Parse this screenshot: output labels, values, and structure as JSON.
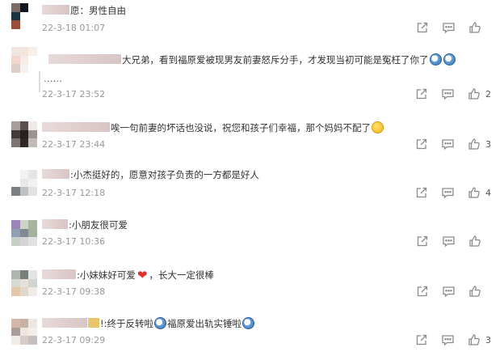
{
  "comments": [
    {
      "avatar": [
        "#7b6b66",
        "#0f1620",
        "#ffffff",
        "#1a3340",
        "#ffffff",
        "#ffffff",
        "#9a4b3c",
        "#ffffff",
        "#ffffff"
      ],
      "prefix": "愿：",
      "text": "男性自由",
      "time": "22-3-18 01:07",
      "likes": "",
      "icons": [
        "share-icon",
        "comment-icon",
        "like-icon"
      ]
    },
    {
      "avatar": [
        "#efe6e2",
        "#f3e4dc",
        "#f8efe9",
        "#f4d6cf",
        "#f5ece8",
        "#ffffff",
        "#ddcfc8",
        "#f7f2ef",
        "#ffffff"
      ],
      "prefix": "大兄弟",
      "text": "，看到福原爱被现男友前妻怒斥分手，才发现当初可能是冤枉了你了",
      "reply": "……",
      "time": "22-3-17 23:52",
      "likes": "2",
      "icons": [
        "share-icon",
        "comment-icon",
        "like-icon"
      ]
    },
    {
      "avatar": [
        "#a79e99",
        "#5a5050",
        "#efe9e6",
        "#433b39",
        "#291f20",
        "#9c938f",
        "#7e7572",
        "#2d2728",
        "#c2bbb7"
      ],
      "prefix": "",
      "text": "唉一句前妻的坏话也没说，祝您和孩子们幸福，那个妈妈不配了",
      "time": "22-3-17 23:44",
      "likes": "3",
      "icons": [
        "share-icon",
        "comment-icon",
        "like-icon"
      ]
    },
    {
      "avatar": [
        "#ffffff",
        "#f2f2f2",
        "#e5e5e5",
        "#ffffff",
        "#e8e8e8",
        "#f1f1f1",
        "#7c7e83",
        "#bfc0c2",
        "#e2e2e2"
      ],
      "prefix": "",
      "text": ":小杰挺好的，愿意对孩子负责的一方都是好人",
      "time": "22-3-17 12:18",
      "likes": "4",
      "icons": [
        "share-icon",
        "comment-icon",
        "like-icon"
      ]
    },
    {
      "avatar": [
        "#9a86b6",
        "#cdd4c6",
        "#a8b59a",
        "#8fa0b2",
        "#7f8a91",
        "#a4b19d",
        "#c8cfc4",
        "#d5d5d5",
        "#e2e2e2"
      ],
      "prefix": "",
      "text": ":小朋友很可爱",
      "time": "22-3-17 10:36",
      "likes": "",
      "icons": [
        "share-icon",
        "comment-icon",
        "like-icon"
      ]
    },
    {
      "avatar": [
        "#aeb4ae",
        "#777f79",
        "#e3e4e3",
        "#d6dad3",
        "#e7e0d8",
        "#d2d5cd",
        "#e3c8aa",
        "#ded8cf",
        "#f0ebe6"
      ],
      "prefix": "",
      "text": ":小妹妹好可爱",
      "text2": "，长大一定很棒",
      "time": "22-3-17 09:38",
      "likes": "",
      "icons": [
        "share-icon",
        "comment-icon",
        "like-icon"
      ]
    },
    {
      "avatar": [
        "#d4b9aa",
        "#c7b1a6",
        "#ece7e3",
        "#a99c99",
        "#f0e6e0",
        "#f5ede8",
        "#f2ece8",
        "#d8ccc6",
        "#c5c0be"
      ],
      "prefix": "",
      "text": "!:终于反转啦",
      "text2": "福原爱出轨实锤啦",
      "time": "22-3-17 09:29",
      "likes": "3",
      "icons": [
        "share-icon",
        "comment-icon",
        "like-icon"
      ]
    }
  ]
}
